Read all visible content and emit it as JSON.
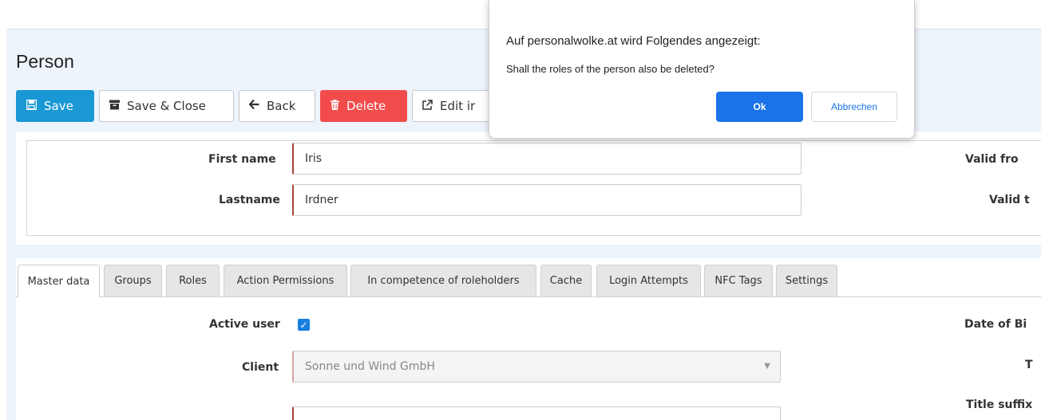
{
  "page": {
    "title": "Person"
  },
  "toolbar": {
    "save": {
      "label": "Save",
      "icon": "floppy-disk-icon"
    },
    "save_close": {
      "label": "Save & Close",
      "icon": "archive-box-icon"
    },
    "back": {
      "label": "Back",
      "icon": "arrow-left-icon"
    },
    "delete": {
      "label": "Delete",
      "icon": "trash-icon"
    },
    "edit": {
      "label": "Edit ir",
      "icon": "external-link-icon"
    }
  },
  "header_form": {
    "first_name": {
      "label": "First name",
      "value": "Iris"
    },
    "lastname": {
      "label": "Lastname",
      "value": "Irdner"
    },
    "valid_from_label": "Valid fro",
    "valid_to_label": "Valid t"
  },
  "tabs": [
    {
      "label": "Master data",
      "active": true
    },
    {
      "label": "Groups",
      "active": false
    },
    {
      "label": "Roles",
      "active": false
    },
    {
      "label": "Action Permissions",
      "active": false
    },
    {
      "label": "In competence of roleholders",
      "active": false
    },
    {
      "label": "Cache",
      "active": false
    },
    {
      "label": "Login Attempts",
      "active": false
    },
    {
      "label": "NFC Tags",
      "active": false
    },
    {
      "label": "Settings",
      "active": false
    }
  ],
  "master_data": {
    "active_user": {
      "label": "Active user",
      "checked": true
    },
    "client": {
      "label": "Client",
      "value": "Sonne und Wind GmbH"
    },
    "date_of_birth_label": "Date of Bi",
    "title_label": "T",
    "title_suffix_label": "Title suffix"
  },
  "dialog": {
    "title": "Auf personalwolke.at wird Folgendes angezeigt:",
    "message": "Shall the roles of the person also be deleted?",
    "ok_label": "Ok",
    "cancel_label": "Abbrechen"
  },
  "colors": {
    "primary": "#1a98d5",
    "danger": "#f24b4b",
    "dialog_button": "#1a73e8",
    "page_background": "#eef4fb"
  }
}
